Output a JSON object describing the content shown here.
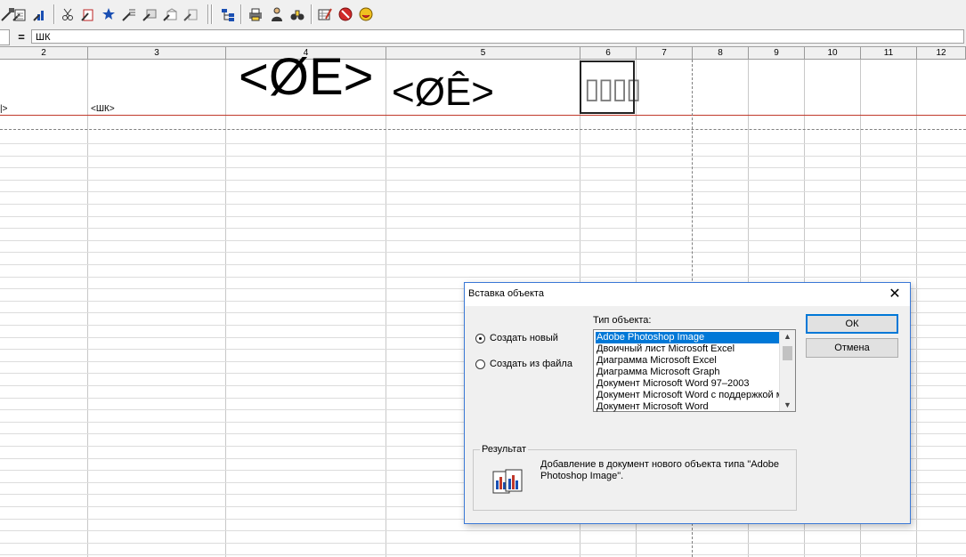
{
  "toolbar": {
    "icons": [
      "wand-brush-icon",
      "wand-page-icon",
      "wand-chart-icon",
      "wand-cut-icon",
      "wand-paste-icon",
      "wand-star-icon",
      "wand-lines-icon",
      "wand-image-icon",
      "wand-box-icon",
      "wand-list-icon",
      "table-tree-icon",
      "printer-stack-icon",
      "person-icon",
      "binoculars-icon",
      "table-edit-icon",
      "stop-sign-icon",
      "smile-icon"
    ]
  },
  "formula_bar": {
    "eq_label": "=",
    "value": "ШК"
  },
  "sheet": {
    "columns": [
      "2",
      "3",
      "4",
      "5",
      "6",
      "7",
      "8",
      "9",
      "10",
      "11",
      "12"
    ],
    "cell_text_left": "|>",
    "cell_text_shk": "<ШК>",
    "big_text_1": "<ØE>",
    "big_text_2": "<ØÊ>",
    "boxes_text": "▯▯▯▯"
  },
  "dialog": {
    "title": "Вставка объекта",
    "close_label": "✕",
    "radio_new": "Создать новый",
    "radio_file": "Создать из файла",
    "list_label": "Тип объекта:",
    "list_items": [
      "Adobe Photoshop Image",
      "Двоичный лист Microsoft Excel",
      "Диаграмма Microsoft Excel",
      "Диаграмма Microsoft Graph",
      "Документ Microsoft Word 97–2003",
      "Документ Microsoft Word с поддержкой м",
      "Документ Microsoft Word"
    ],
    "ok_label": "ОК",
    "cancel_label": "Отмена",
    "result_label": "Результат",
    "result_text": "Добавление в документ нового объекта типа \"Adobe Photoshop Image\".",
    "colors": {
      "accent": "#0078d7",
      "border": "#3a78d6"
    }
  }
}
